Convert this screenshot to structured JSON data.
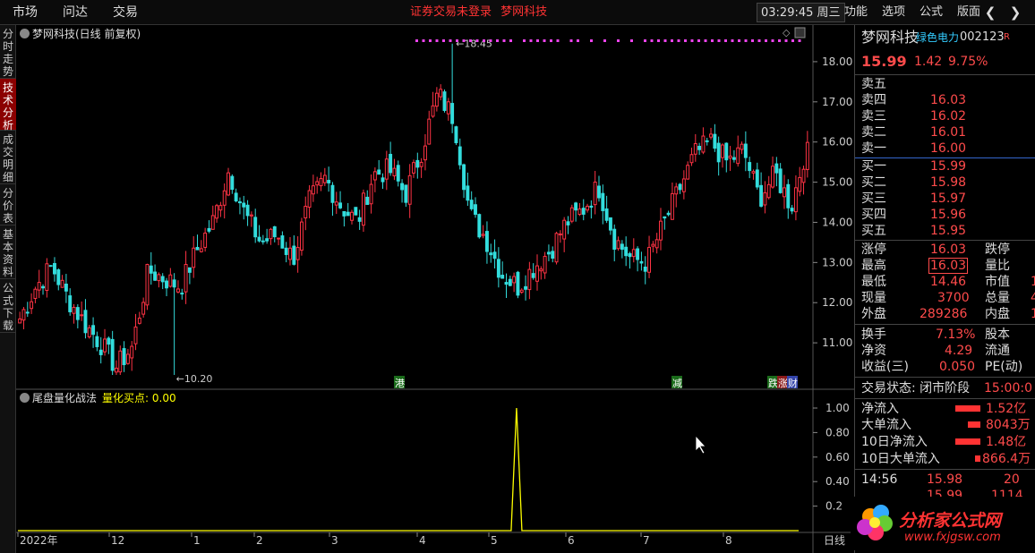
{
  "topbar": {
    "menus": [
      "市场",
      "问达",
      "交易"
    ],
    "title_parts": [
      "证券交易未登录",
      "梦网科技"
    ],
    "clock": "03:29:45 周三",
    "right_menus": [
      "功能",
      "选项",
      "公式",
      "版面"
    ]
  },
  "left_tabs": [
    "分时走势",
    "技术分析",
    "成交明细",
    "分价表",
    "基本资料",
    "公式下载"
  ],
  "main_chart": {
    "label": "梦网科技(日线 前复权)",
    "high_label": "18.45",
    "low_label": "10.20",
    "y_ticks": [
      "18.00",
      "17.00",
      "16.00",
      "15.00",
      "14.00",
      "13.00",
      "12.00",
      "11.00"
    ],
    "event_markers": [
      "港",
      "减",
      "跌",
      "涨",
      "财"
    ]
  },
  "sub_chart": {
    "indicator": "尾盘量化战法",
    "value_label": "量化买点: 0.00",
    "y_ticks": [
      "1.00",
      "0.80",
      "0.60",
      "0.40",
      "0.2"
    ]
  },
  "x_axis": {
    "labels": [
      "2022年",
      "12",
      "1",
      "2",
      "3",
      "4",
      "5",
      "6",
      "7",
      "8"
    ],
    "period": "日线"
  },
  "chart_data": {
    "type": "candlestick",
    "title": "梦网科技(日线 前复权)",
    "ylim": [
      10.0,
      18.6
    ],
    "max_price": 18.45,
    "min_price": 10.2,
    "approx_closes": [
      11.6,
      12.4,
      12.9,
      12.1,
      11.5,
      11.0,
      10.4,
      10.9,
      12.8,
      12.6,
      12.4,
      13.3,
      14.0,
      15.3,
      14.2,
      13.5,
      13.7,
      13.1,
      14.5,
      15.1,
      14.4,
      14.0,
      15.2,
      15.3,
      14.7,
      15.8,
      17.2,
      16.6,
      14.2,
      13.6,
      12.7,
      12.4,
      12.9,
      13.3,
      14.0,
      14.3,
      14.9,
      13.6,
      13.1,
      13.0,
      13.9,
      14.8,
      15.7,
      16.0,
      15.5,
      15.8,
      14.6,
      15.2,
      14.4,
      15.99
    ],
    "indicator_series": {
      "name": "量化买点",
      "spike_value": 1.0,
      "spike_position_fraction": 0.63
    }
  },
  "panel": {
    "stock_name": "梦网科技",
    "tag": "绿色电力",
    "code": "002123",
    "badge": "R",
    "price": "15.99",
    "change": "1.42",
    "change_pct": "9.75%",
    "sell_header": "卖五",
    "asks": [
      {
        "label": "卖四",
        "price": "16.03"
      },
      {
        "label": "卖三",
        "price": "16.02"
      },
      {
        "label": "卖二",
        "price": "16.01"
      },
      {
        "label": "卖一",
        "price": "16.00"
      }
    ],
    "bids": [
      {
        "label": "买一",
        "price": "15.99"
      },
      {
        "label": "买二",
        "price": "15.98"
      },
      {
        "label": "买三",
        "price": "15.97"
      },
      {
        "label": "买四",
        "price": "15.96"
      },
      {
        "label": "买五",
        "price": "15.95"
      }
    ],
    "stats": [
      {
        "k1": "涨停",
        "v1": "16.03",
        "k2": "跌停",
        "v2": ""
      },
      {
        "k1": "最高",
        "v1": "16.03",
        "k2": "量比",
        "v2": ""
      },
      {
        "k1": "最低",
        "v1": "14.46",
        "k2": "市值",
        "v2": "1"
      },
      {
        "k1": "现量",
        "v1": "3700",
        "k2": "总量",
        "v2": "4"
      },
      {
        "k1": "外盘",
        "v1": "289286",
        "k2": "内盘",
        "v2": "1"
      }
    ],
    "stats2": [
      {
        "k1": "换手",
        "v1": "7.13%",
        "k2": "股本"
      },
      {
        "k1": "净资",
        "v1": "4.29",
        "k2": "流通"
      },
      {
        "k1": "收益(三)",
        "v1": "0.050",
        "k2": "PE(动)"
      }
    ],
    "trade_status_label": "交易状态: 闭市阶段",
    "trade_status_time": "15:00:0",
    "flows": [
      {
        "k": "净流入",
        "v": "1.52亿",
        "bar": 1.0
      },
      {
        "k": "大单流入",
        "v": "8043万",
        "bar": 0.5
      },
      {
        "k": "10日净流入",
        "v": "1.48亿",
        "bar": 1.0
      },
      {
        "k": "10日大单流入",
        "v": "866.4万",
        "bar": 0.2
      }
    ],
    "ticks": [
      {
        "time": "14:56",
        "price": "15.98",
        "vol": "20"
      },
      {
        "time": "",
        "price": "15.99",
        "vol": "1114"
      }
    ]
  },
  "watermark_logo": {
    "text": "分析家公式网",
    "url_text": "www.fxjgsw.com"
  }
}
